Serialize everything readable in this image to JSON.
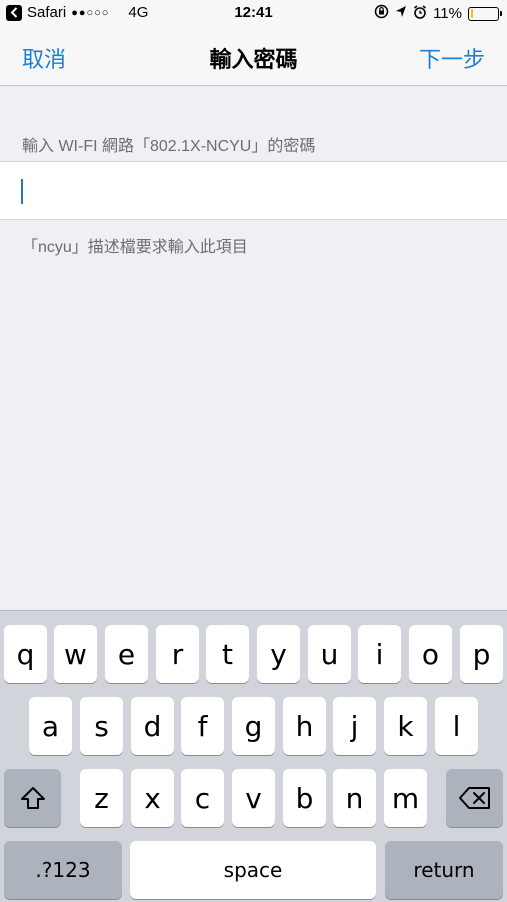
{
  "status_bar": {
    "back_app": "Safari",
    "signal": "●●○○○",
    "network": "4G",
    "time": "12:41",
    "battery_percent": "11%",
    "battery_level": 0.11
  },
  "nav": {
    "cancel_label": "取消",
    "title": "輸入密碼",
    "next_label": "下一步"
  },
  "form": {
    "section_header": "輸入 WI-FI 網路「802.1X-NCYU」的密碼",
    "password_value": "",
    "footer_note": "「ncyu」描述檔要求輸入此項目"
  },
  "keyboard": {
    "row1": [
      "q",
      "w",
      "e",
      "r",
      "t",
      "y",
      "u",
      "i",
      "o",
      "p"
    ],
    "row2": [
      "a",
      "s",
      "d",
      "f",
      "g",
      "h",
      "j",
      "k",
      "l"
    ],
    "row3": [
      "z",
      "x",
      "c",
      "v",
      "b",
      "n",
      "m"
    ],
    "numbers_label": ".?123",
    "space_label": "space",
    "return_label": "return"
  },
  "colors": {
    "accent": "#1a7fd8",
    "background": "#efeff4",
    "keyboard_bg": "#d1d5db",
    "battery": "#f5c400"
  }
}
